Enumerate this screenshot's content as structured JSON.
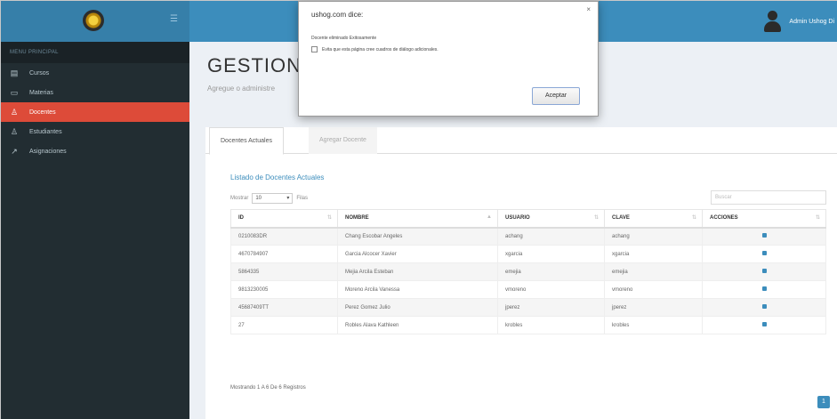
{
  "topbar": {
    "user_name": "Admin Ushog Di"
  },
  "sidebar": {
    "header": "MENU PRINCIPAL",
    "items": [
      {
        "label": "Cursos",
        "icon": "book-icon"
      },
      {
        "label": "Materias",
        "icon": "folder-icon"
      },
      {
        "label": "Docentes",
        "icon": "user-icon",
        "active": true
      },
      {
        "label": "Estudiantes",
        "icon": "user-icon"
      },
      {
        "label": "Asignaciones",
        "icon": "chart-icon"
      }
    ]
  },
  "page": {
    "title": "GESTION",
    "subtitle": "Agregue o administre"
  },
  "tabs": [
    "Docentes Actuales",
    "Agregar Docente"
  ],
  "list": {
    "title": "Listado de Docentes Actuales",
    "show_prefix": "Mostrar",
    "show_value": "10",
    "show_suffix": "Filas",
    "search_placeholder": "Buscar",
    "columns": [
      "ID",
      "NOMBRE",
      "USUARIO",
      "CLAVE",
      "ACCIONES"
    ],
    "rows": [
      {
        "id": "0210083DR",
        "nombre": "Chang Escobar Angeles",
        "usuario": "achang",
        "clave": "achang"
      },
      {
        "id": "4670784907",
        "nombre": "Garcia Alcocer Xavier",
        "usuario": "xgarcia",
        "clave": "xgarcia"
      },
      {
        "id": "5864335",
        "nombre": "Mejia Arcila Esteban",
        "usuario": "emejia",
        "clave": "emejia"
      },
      {
        "id": "9813230005",
        "nombre": "Moreno Arcila Vanessa",
        "usuario": "vmoreno",
        "clave": "vmoreno"
      },
      {
        "id": "45687409TT",
        "nombre": "Perez Gomez Julio",
        "usuario": "jperez",
        "clave": "jperez"
      },
      {
        "id": "27",
        "nombre": "Robles Alava Kathleen",
        "usuario": "krobles",
        "clave": "krobles"
      }
    ],
    "footer": "Mostrando 1 A 6 De 6 Registros",
    "page_number": "1"
  },
  "dialog": {
    "title": "ushog.com dice:",
    "close": "×",
    "message": "Docente eliminado Exitosamente",
    "checkbox_label": "Evita que esta página cree cuadros de diálogo adicionales.",
    "ok_label": "Aceptar"
  },
  "colors": {
    "topbar": "#3c8dbc",
    "sidebar": "#222d32",
    "active_item": "#dd4b39",
    "content_bg": "#ecf0f5"
  }
}
